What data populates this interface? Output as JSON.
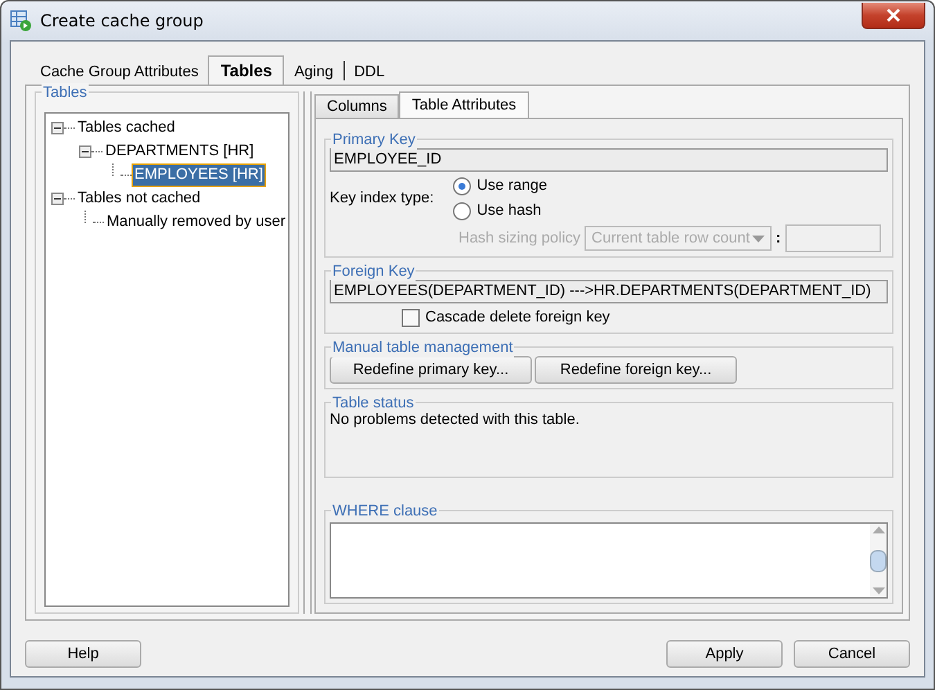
{
  "window": {
    "title": "Create cache group"
  },
  "tabs": [
    {
      "label": "Cache Group Attributes",
      "selected": false
    },
    {
      "label": "Tables",
      "selected": true
    },
    {
      "label": "Aging",
      "selected": false
    },
    {
      "label": "DDL",
      "selected": false
    }
  ],
  "tables_panel": {
    "title": "Tables",
    "tree": [
      {
        "label": "Tables cached",
        "expanded": true,
        "selected": false,
        "children": [
          {
            "label": "DEPARTMENTS [HR]",
            "expanded": true,
            "selected": false,
            "children": [
              {
                "label": "EMPLOYEES [HR]",
                "selected": true
              }
            ]
          }
        ]
      },
      {
        "label": "Tables not cached",
        "expanded": true,
        "selected": false,
        "children": [
          {
            "label": "Manually removed by user",
            "selected": false
          }
        ]
      }
    ]
  },
  "subtabs": [
    {
      "label": "Columns",
      "selected": false
    },
    {
      "label": "Table Attributes",
      "selected": true
    }
  ],
  "primary_key": {
    "title": "Primary Key",
    "value": "EMPLOYEE_ID",
    "key_index_label": "Key index type:",
    "options": [
      {
        "label": "Use range",
        "selected": true
      },
      {
        "label": "Use hash",
        "selected": false
      }
    ],
    "hash_sizing": {
      "label": "Hash sizing policy",
      "value": "Current table row count",
      "separator": ":",
      "disabled": true
    }
  },
  "foreign_key": {
    "title": "Foreign Key",
    "value": "EMPLOYEES(DEPARTMENT_ID) --->HR.DEPARTMENTS(DEPARTMENT_ID)",
    "cascade": {
      "label": "Cascade delete foreign key",
      "checked": false
    }
  },
  "manual": {
    "title": "Manual table management",
    "buttons": [
      "Redefine primary key...",
      "Redefine foreign key..."
    ]
  },
  "table_status": {
    "title": "Table status",
    "message": "No problems detected with this table."
  },
  "where_clause": {
    "title": "WHERE clause"
  },
  "buttons": [
    {
      "label": "Help",
      "kind": "left"
    },
    {
      "label": "Apply",
      "kind": "right"
    },
    {
      "label": "Cancel",
      "kind": "right"
    }
  ]
}
